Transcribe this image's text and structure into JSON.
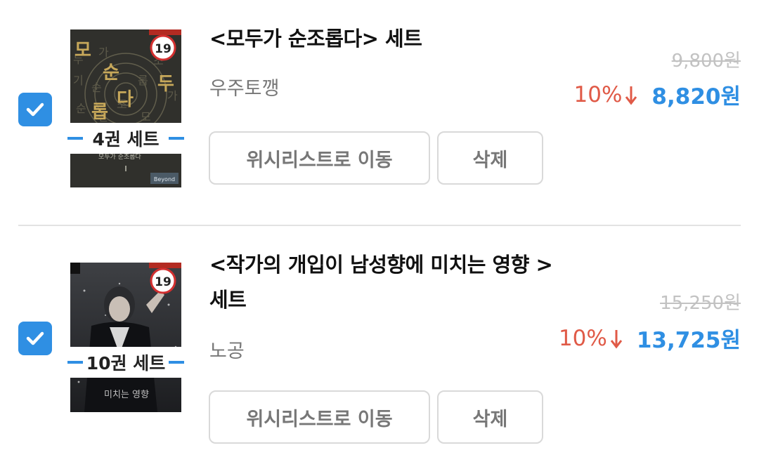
{
  "items": [
    {
      "title": "<모두가 순조롭다> 세트",
      "author": "우주토깽",
      "set_badge": "4권 세트",
      "cover_age": "19",
      "cover_big_text": [
        "모",
        "순",
        "다",
        "롭",
        "두"
      ],
      "cover_bottom_text": "모두가 순조롭다",
      "cover_publisher": "Beyond",
      "wishlist_label": "위시리스트로 이동",
      "delete_label": "삭제",
      "original_price": "9,800원",
      "discount": "10%",
      "final_price": "8,820원",
      "checked": true
    },
    {
      "title": "<작가의 개입이 남성향에 미치는 영향 > 세트",
      "author": "노공",
      "set_badge": "10권 세트",
      "cover_age": "19",
      "cover_bottom_text": "미치는 영향",
      "wishlist_label": "위시리스트로 이동",
      "delete_label": "삭제",
      "original_price": "15,250원",
      "discount": "10%",
      "final_price": "13,725원",
      "checked": true
    }
  ],
  "colors": {
    "accent": "#2f8fe3",
    "discount": "#e05a47",
    "muted": "#777777",
    "strike": "#c2c2c2"
  },
  "icons": {
    "checkbox": "checkmark-icon",
    "discount_arrow": "arrow-down-icon",
    "age_rating": "age-19-badge-icon"
  }
}
